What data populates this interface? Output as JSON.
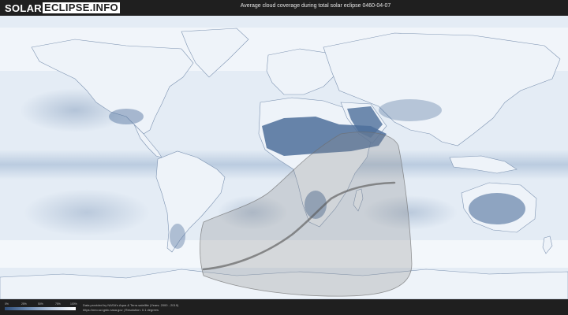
{
  "header": {
    "logo_part1": "SOLAR",
    "logo_part2": "ECLIPSE.INFO",
    "title": "Average cloud coverage during total solar eclipse 0460-04-07"
  },
  "map": {
    "layer": "average-cloud-coverage",
    "colors": {
      "ocean_base": "#e4ecf5",
      "land_base": "#e9eff6",
      "cloud_free": "#3d5d89",
      "cloud_mid": "#7d9bc1",
      "eclipse_area_fill": "#8a8a8a",
      "eclipse_path": "#5a5a5a"
    }
  },
  "footer": {
    "legend_ticks": [
      "0%",
      "25%",
      "50%",
      "75%",
      "100%"
    ],
    "credit_line1": "Data provided by NASA's Aqua & Terra satellite (Years: 2000 - 2019)",
    "credit_line2": "https://neo.sci.gsfc.nasa.gov | Resolution: 0.1 degrees"
  }
}
